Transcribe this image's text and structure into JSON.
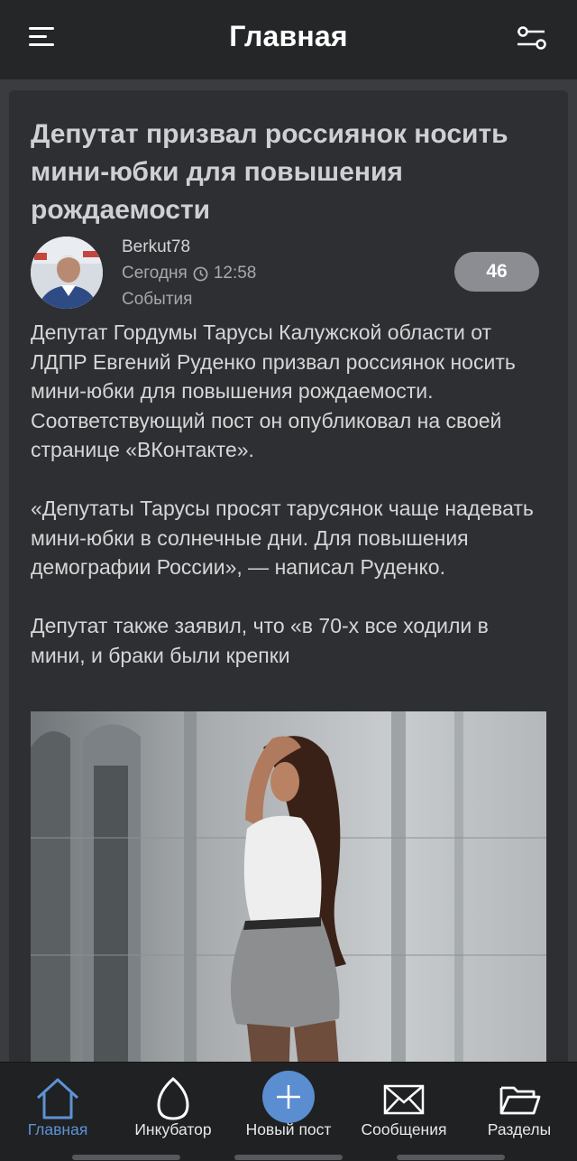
{
  "header": {
    "title": "Главная",
    "menu_icon": "hamburger-menu-icon",
    "filter_icon": "filter-sliders-icon"
  },
  "post": {
    "title": "Депутат призвал россиянок носить мини-юбки для повышения рождаемости",
    "author": "Berkut78",
    "date": "Сегодня",
    "time": "12:58",
    "category": "События",
    "comments_count": "46",
    "paragraphs": [
      "Депутат Гордумы Тарусы Калужской области от ЛДПР Евгений Руденко призвал россиянок носить мини-юбки для повышения рождаемости. Соответствующий пост он опубликовал на своей странице «ВКонтакте».",
      "«Депутаты Тарусы просят тарусянок чаще надевать мини-юбки в солнечные дни. Для повышения демографии России», — написал Руденко.",
      "Депутат также заявил, что «в 70-х все ходили в мини, и браки были крепки"
    ]
  },
  "bottom_nav": {
    "items": [
      {
        "label": "Главная",
        "icon": "home-icon",
        "active": true
      },
      {
        "label": "Инкубатор",
        "icon": "egg-icon",
        "active": false
      },
      {
        "label": "Новый пост",
        "icon": "plus-icon",
        "active": false
      },
      {
        "label": "Сообщения",
        "icon": "envelope-icon",
        "active": false
      },
      {
        "label": "Разделы",
        "icon": "folder-icon",
        "active": false
      }
    ]
  },
  "colors": {
    "accent": "#5f92d6",
    "new_post_button": "#5b8dd1",
    "background": "#3a3c40",
    "card": "#2d2f33"
  }
}
